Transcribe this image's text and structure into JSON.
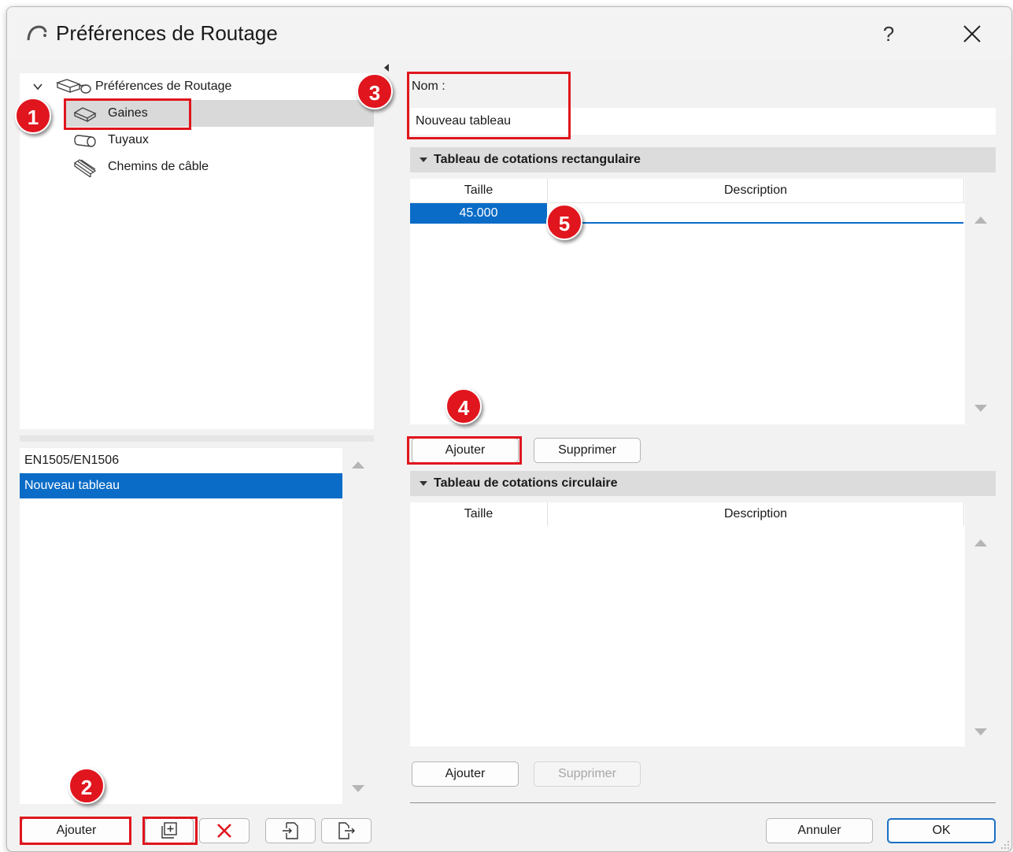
{
  "window": {
    "title": "Préférences de Routage",
    "help": "?"
  },
  "tree": {
    "root": "Préférences de Routage",
    "items": [
      "Gaines",
      "Tuyaux",
      "Chemins de câble"
    ]
  },
  "standards": [
    "EN1505/EN1506",
    "Nouveau tableau"
  ],
  "left_buttons": {
    "add": "Ajouter"
  },
  "name_label": "Nom :",
  "name_value": "Nouveau tableau",
  "rect_table": {
    "title": "Tableau de cotations rectangulaire",
    "columns": [
      "Taille",
      "Description"
    ],
    "rows": [
      {
        "taille": "45.000",
        "description": ""
      }
    ],
    "add": "Ajouter",
    "remove": "Supprimer"
  },
  "circ_table": {
    "title": "Tableau de cotations circulaire",
    "columns": [
      "Taille",
      "Description"
    ],
    "rows": [],
    "add": "Ajouter",
    "remove": "Supprimer"
  },
  "footer": {
    "cancel": "Annuler",
    "ok": "OK"
  },
  "annotations": [
    "1",
    "2",
    "3",
    "4",
    "5"
  ],
  "colors": {
    "highlight": "#e0151d",
    "selection": "#0a6cc7",
    "accent": "#1a6fc4"
  }
}
